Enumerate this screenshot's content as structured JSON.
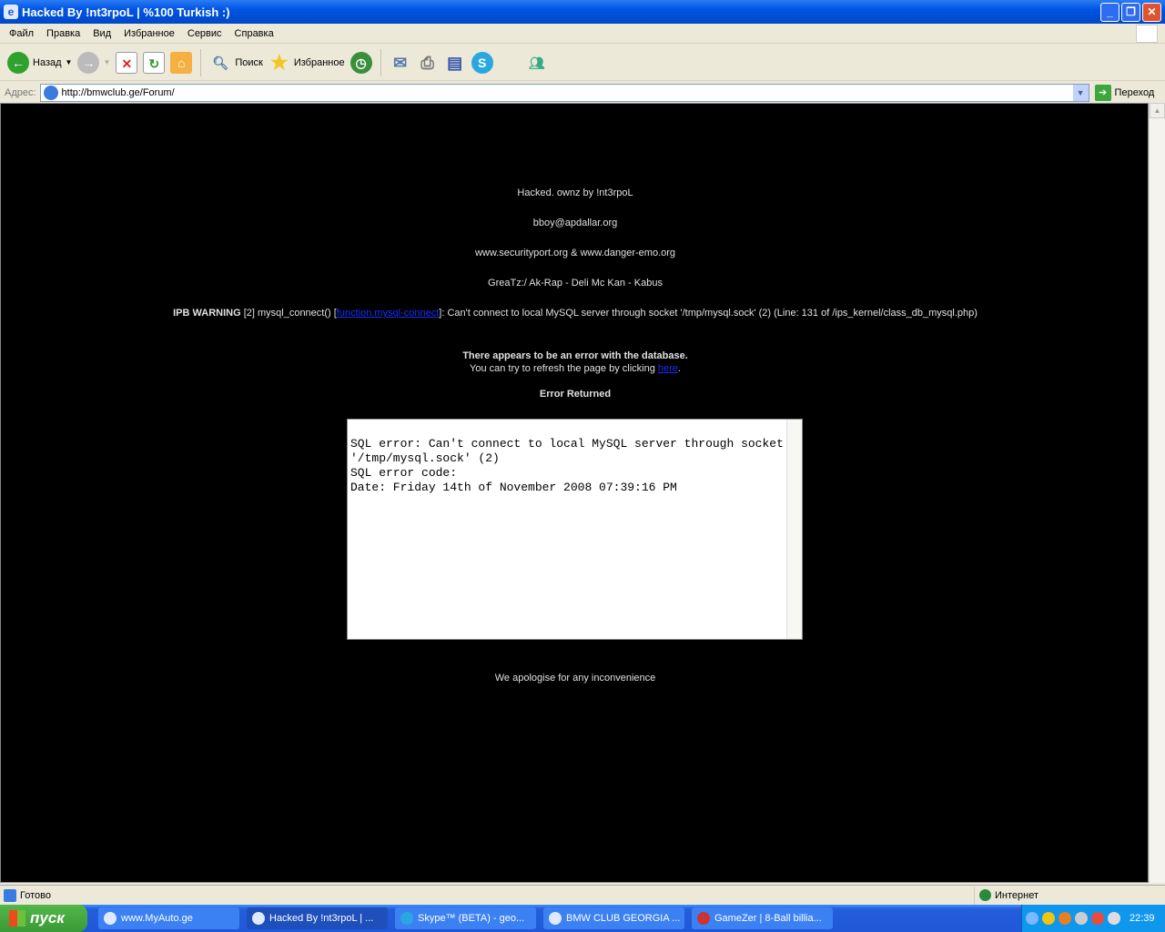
{
  "window": {
    "title": "Hacked By !nt3rpoL | %100 Turkish :)"
  },
  "menu": [
    "Файл",
    "Правка",
    "Вид",
    "Избранное",
    "Сервис",
    "Справка"
  ],
  "toolbar": {
    "back": "Назад",
    "search": "Поиск",
    "favorites": "Избранное"
  },
  "address": {
    "label": "Адрес:",
    "url": "http://bmwclub.ge/Forum/",
    "go": "Переход"
  },
  "page": {
    "line1": "Hacked. ownz by !nt3rpoL",
    "line2": "bboy@apdallar.org",
    "line3": "www.securityport.org & www.danger-emo.org",
    "line4": "GreaTz:/ Ak-Rap - Deli Mc Kan - Kabus",
    "warn_label": "IPB WARNING",
    "warn_pre": " [2] mysql_connect() [",
    "warn_link": "function.mysql-connect",
    "warn_post": "]: Can't connect to local MySQL server through socket '/tmp/mysql.sock' (2) (Line: 131 of /ips_kernel/class_db_mysql.php)",
    "db_error": "There appears to be an error with the database.",
    "refresh_pre": "You can try to refresh the page by clicking ",
    "refresh_link": "here",
    "refresh_post": ".",
    "error_returned": "Error Returned",
    "error_text": "SQL error: Can't connect to local MySQL server through socket '/tmp/mysql.sock' (2)\nSQL error code:\nDate: Friday 14th of November 2008 07:39:16 PM",
    "apology": "We apologise for any inconvenience"
  },
  "status": {
    "text": "Готово",
    "zone": "Интернет"
  },
  "taskbar": {
    "start": "пуск",
    "tasks": [
      "www.MyAuto.ge",
      "Hacked By !nt3rpoL | ...",
      "Skype™ (BETA) - geo...",
      "BMW CLUB GEORGIA ...",
      "GameZer | 8-Ball billia..."
    ],
    "clock": "22:39"
  }
}
